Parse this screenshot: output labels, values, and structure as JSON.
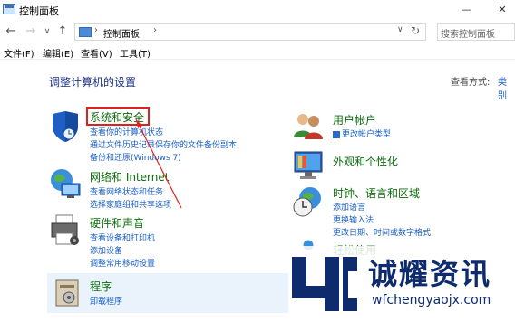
{
  "window": {
    "title": "控制面板",
    "controls": {
      "minimize": "—",
      "close": "✕"
    }
  },
  "nav": {
    "back": "←",
    "forward": "→",
    "dropdown": "∨",
    "up": "↑"
  },
  "address": {
    "separator": "›",
    "crumb": "控制面板",
    "separator2": "›",
    "dropdown": "∨",
    "refresh": "↻"
  },
  "search": {
    "placeholder": "搜索控制面板"
  },
  "menu": {
    "file": "文件(F)",
    "edit": "编辑(E)",
    "view": "查看(V)",
    "tools": "工具(T)"
  },
  "page": {
    "heading": "调整计算机的设置",
    "view_by_label": "查看方式:",
    "view_by_value": "类别"
  },
  "left_categories": [
    {
      "title": "系统和安全",
      "icon": "shield-icon",
      "links": [
        "查看你的计算机状态",
        "通过文件历史记录保存你的文件备份副本",
        "备份和还原(Windows 7)"
      ]
    },
    {
      "title": "网络和 Internet",
      "icon": "network-icon",
      "links": [
        "查看网络状态和任务",
        "选择家庭组和共享选项"
      ]
    },
    {
      "title": "硬件和声音",
      "icon": "printer-icon",
      "links": [
        "查看设备和打印机",
        "添加设备",
        "调整常用移动设置"
      ]
    },
    {
      "title": "程序",
      "icon": "programs-icon",
      "links": [
        "卸载程序"
      ]
    }
  ],
  "right_categories": [
    {
      "title": "用户帐户",
      "icon": "users-icon",
      "links": [
        "更改帐户类型"
      ]
    },
    {
      "title": "外观和个性化",
      "icon": "display-icon",
      "links": []
    },
    {
      "title": "时钟、语言和区域",
      "icon": "clock-globe-icon",
      "links": [
        "添加语言",
        "更换输入法",
        "更改日期、时间或数字格式"
      ]
    },
    {
      "title": "轻松使用",
      "icon": "ease-icon",
      "links": []
    }
  ],
  "watermark": {
    "brand": "诚耀资讯",
    "url": "wfchengyaojx.com"
  },
  "colors": {
    "heading": "#1e3287",
    "category_title": "#0b6b0b",
    "link": "#1a5fc5",
    "highlight": "#e01f1f",
    "watermark": "#0e2b6e"
  }
}
